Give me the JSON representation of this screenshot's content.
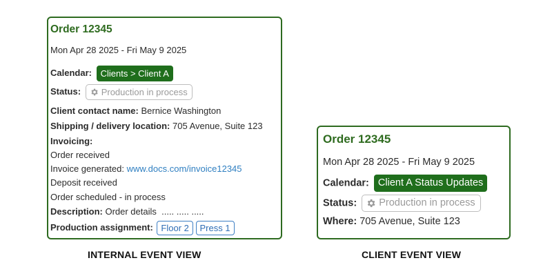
{
  "internal": {
    "title": "Order 12345",
    "dates": "Mon Apr 28 2025 - Fri May 9 2025",
    "calendar_label": "Calendar:",
    "calendar_value": "Clients > Client A",
    "status_label": "Status:",
    "status_value": "Production in process",
    "contact_label": "Client contact name:",
    "contact_value": "Bernice Washington",
    "shipping_label": "Shipping / delivery location:",
    "shipping_value": "705 Avenue, Suite 123",
    "invoicing_label": "Invoicing:",
    "invoicing_lines": [
      "Order received",
      "Deposit received",
      "Order scheduled - in process"
    ],
    "invoice_generated_label": "Invoice generated:",
    "invoice_link": "www.docs.com/invoice12345",
    "description_label": "Description:",
    "description_value": "Order details  ..... ..... .....",
    "production_label": "Production assignment:",
    "production_tags": [
      "Floor 2",
      "Press 1"
    ],
    "caption": "INTERNAL EVENT VIEW"
  },
  "client": {
    "title": "Order 12345",
    "dates": "Mon Apr 28 2025 - Fri May 9 2025",
    "calendar_label": "Calendar:",
    "calendar_value": "Client A Status Updates",
    "status_label": "Status:",
    "status_value": "Production in process",
    "where_label": "Where:",
    "where_value": "705 Avenue, Suite 123",
    "caption": "CLIENT EVENT VIEW"
  },
  "colors": {
    "border_green": "#2d6a1f",
    "title_green": "#2e6b1f",
    "chip_green": "#1f6e1c",
    "link_blue": "#2f7fc1",
    "tag_blue": "#3d7fc4"
  },
  "icons": {
    "status": "gear-icon"
  }
}
